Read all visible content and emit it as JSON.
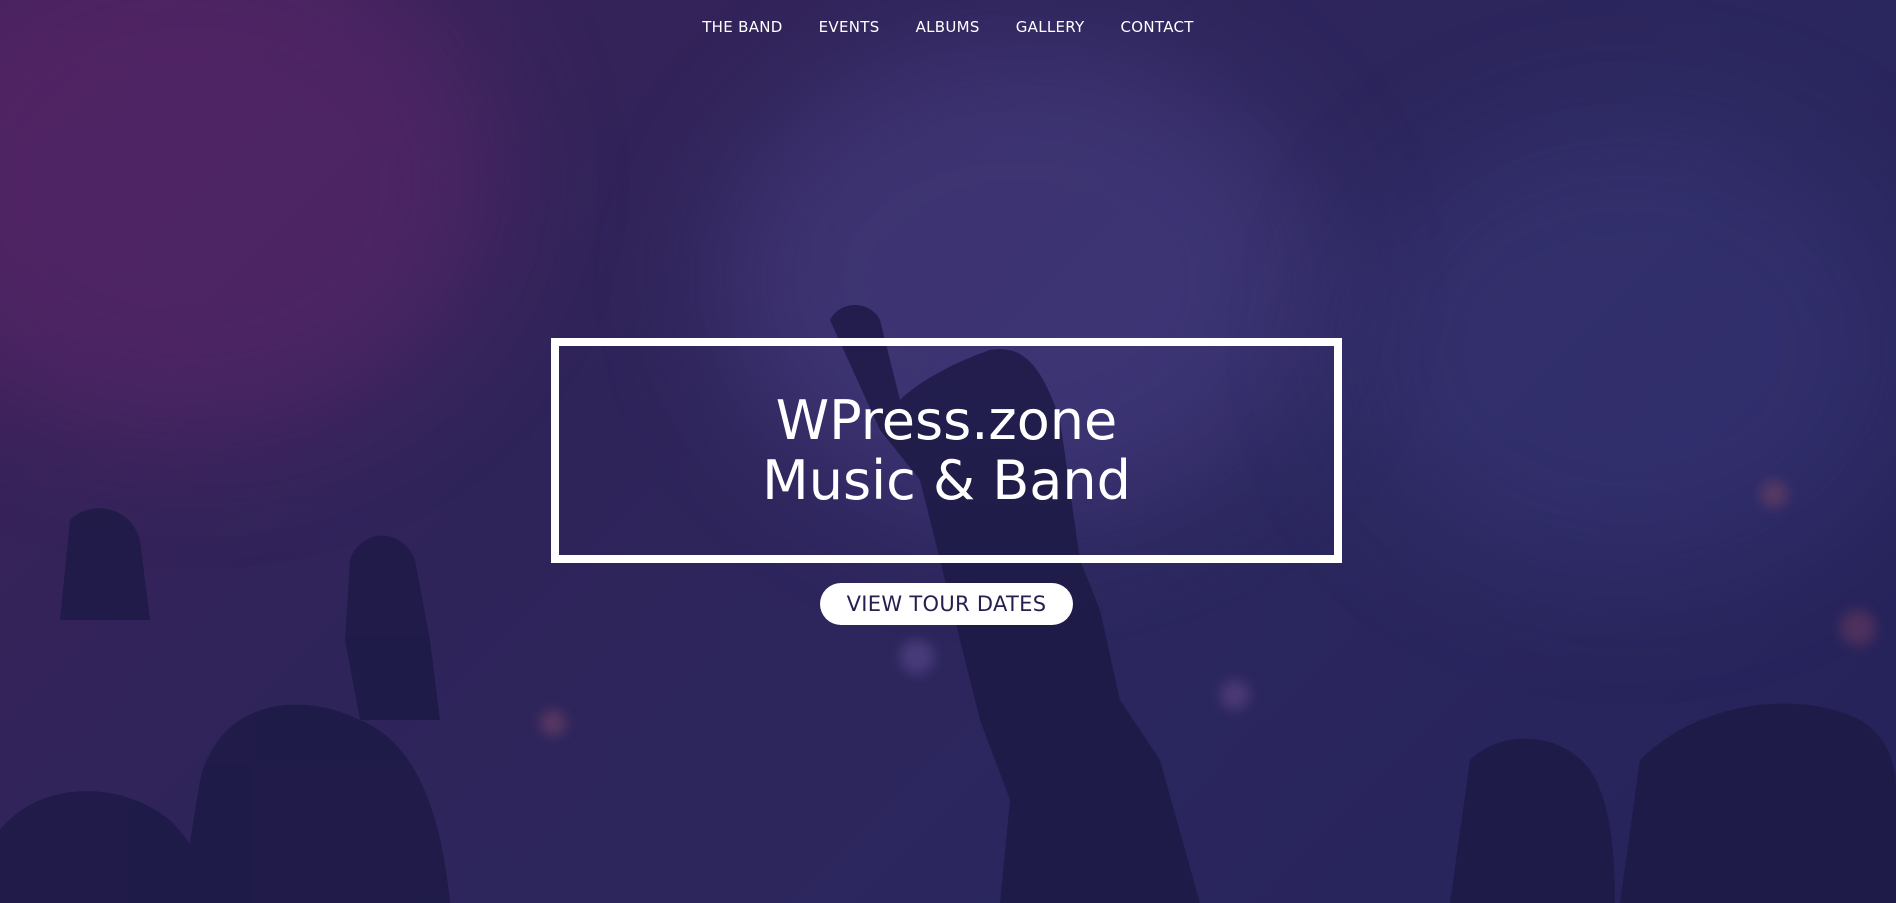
{
  "nav": {
    "items": [
      {
        "label": "THE BAND"
      },
      {
        "label": "EVENTS"
      },
      {
        "label": "ALBUMS"
      },
      {
        "label": "GALLERY"
      },
      {
        "label": "CONTACT"
      }
    ]
  },
  "hero": {
    "title_line1": "WPress.zone",
    "title_line2": "Music & Band",
    "cta_label": "VIEW TOUR DATES"
  },
  "colors": {
    "overlay": "#2b275e",
    "text": "#ffffff",
    "button_text": "#26204f"
  }
}
